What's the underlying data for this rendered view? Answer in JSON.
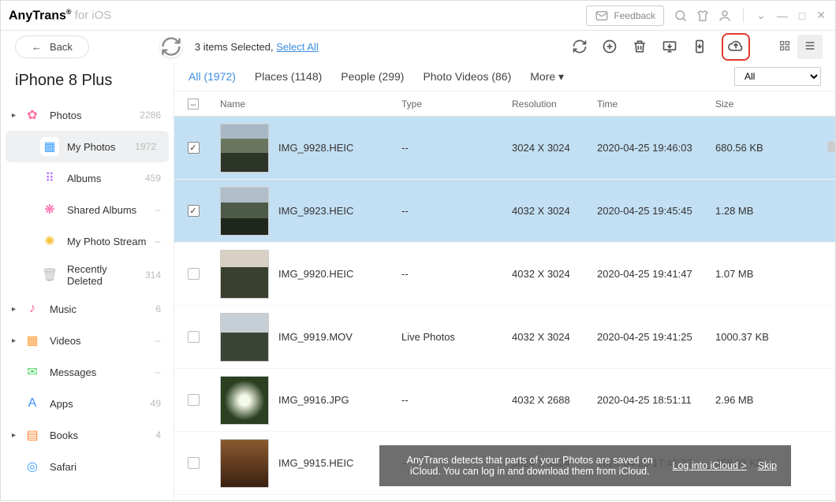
{
  "app": {
    "name": "AnyTrans",
    "sup": "®",
    "platform": "for iOS",
    "feedback": "Feedback"
  },
  "toolbar": {
    "back": "Back",
    "selection_prefix": "3 items Selected, ",
    "select_all": "Select All"
  },
  "device": "iPhone 8 Plus",
  "sidebar": {
    "items": [
      {
        "label": "Photos",
        "count": "2286",
        "arrow": true
      },
      {
        "label": "My Photos",
        "count": "1972",
        "sub": true,
        "selected": true
      },
      {
        "label": "Albums",
        "count": "459",
        "sub": true
      },
      {
        "label": "Shared Albums",
        "count": "--",
        "sub": true
      },
      {
        "label": "My Photo Stream",
        "count": "--",
        "sub": true
      },
      {
        "label": "Recently Deleted",
        "count": "314",
        "sub": true
      },
      {
        "label": "Music",
        "count": "6",
        "arrow": true
      },
      {
        "label": "Videos",
        "count": "--",
        "arrow": true
      },
      {
        "label": "Messages",
        "count": "--"
      },
      {
        "label": "Apps",
        "count": "49"
      },
      {
        "label": "Books",
        "count": "4",
        "arrow": true
      },
      {
        "label": "Safari",
        "count": ""
      }
    ]
  },
  "tabs": [
    {
      "label": "All (1972)",
      "active": true
    },
    {
      "label": "Places (1148)"
    },
    {
      "label": "People (299)"
    },
    {
      "label": "Photo Videos (86)"
    }
  ],
  "more": "More",
  "filter_dd": "All",
  "columns": {
    "name": "Name",
    "type": "Type",
    "res": "Resolution",
    "time": "Time",
    "size": "Size"
  },
  "rows": [
    {
      "sel": true,
      "name": "IMG_9928.HEIC",
      "type": "--",
      "res": "3024 X 3024",
      "time": "2020-04-25 19:46:03",
      "size": "680.56 KB"
    },
    {
      "sel": true,
      "name": "IMG_9923.HEIC",
      "type": "--",
      "res": "4032 X 3024",
      "time": "2020-04-25 19:45:45",
      "size": "1.28 MB"
    },
    {
      "sel": false,
      "name": "IMG_9920.HEIC",
      "type": "--",
      "res": "4032 X 3024",
      "time": "2020-04-25 19:41:47",
      "size": "1.07 MB"
    },
    {
      "sel": false,
      "name": "IMG_9919.MOV",
      "type": "Live Photos",
      "res": "4032 X 3024",
      "time": "2020-04-25 19:41:25",
      "size": "1000.37 KB"
    },
    {
      "sel": false,
      "name": "IMG_9916.JPG",
      "type": "--",
      "res": "4032 X 2688",
      "time": "2020-04-25 18:51:11",
      "size": "2.96 MB"
    },
    {
      "sel": false,
      "name": "IMG_9915.HEIC",
      "type": "--",
      "res": "3024 X 3024",
      "time": "2020-04-25 17:42:22",
      "size": "658.93 KB"
    }
  ],
  "notif": {
    "msg": "AnyTrans detects that parts of your Photos are saved on iCloud. You can log in and download them from iCloud.",
    "link": "Log into iCloud >",
    "skip": "Skip"
  }
}
